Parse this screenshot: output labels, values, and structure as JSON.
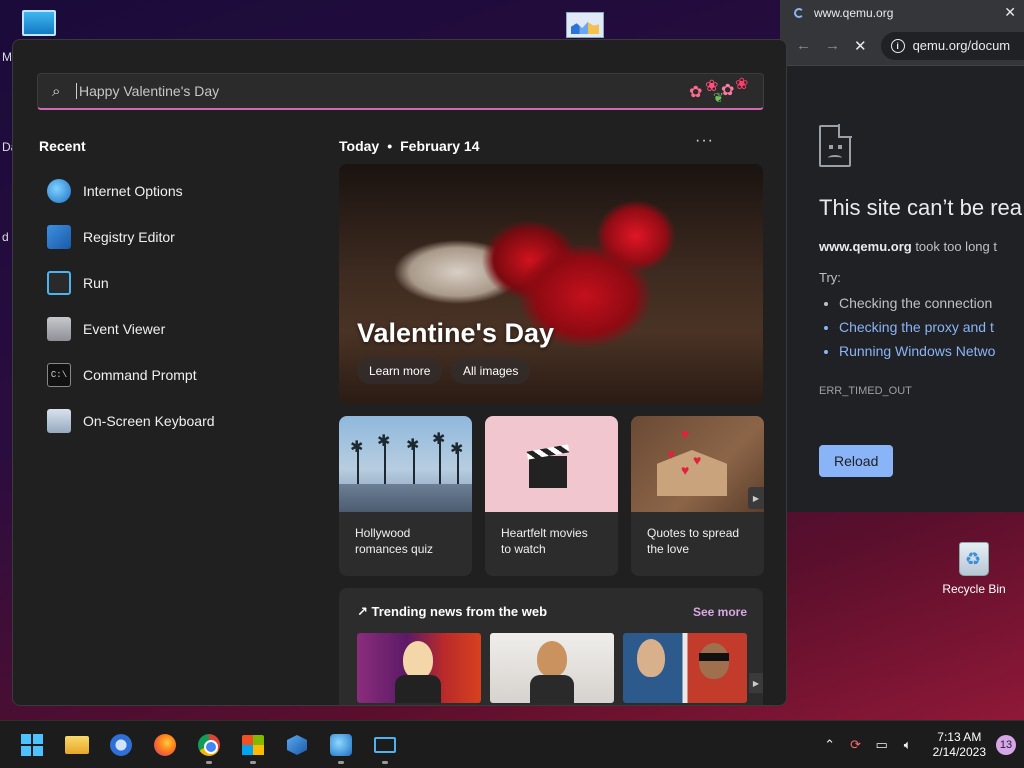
{
  "desktop": {
    "left_letters": [
      "M",
      "Da",
      "d"
    ],
    "recycle_bin_label": "Recycle Bin"
  },
  "browser": {
    "tab_title": "www.qemu.org",
    "tab_close": "✕",
    "url": "qemu.org/docum",
    "error_heading": "This site can’t be rea",
    "msg_host": "www.qemu.org",
    "msg_rest": " took too long t",
    "try_label": "Try:",
    "suggestions": [
      "Checking the connection",
      "Checking the proxy and t",
      "Running Windows Netwo"
    ],
    "error_code": "ERR_TIMED_OUT",
    "reload_label": "Reload"
  },
  "search": {
    "placeholder": "Happy Valentine's Day"
  },
  "recent": {
    "title": "Recent",
    "items": [
      {
        "label": "Internet Options",
        "icon": "internet-options-icon"
      },
      {
        "label": "Registry Editor",
        "icon": "registry-editor-icon"
      },
      {
        "label": "Run",
        "icon": "run-icon"
      },
      {
        "label": "Event Viewer",
        "icon": "event-viewer-icon"
      },
      {
        "label": "Command Prompt",
        "icon": "command-prompt-icon"
      },
      {
        "label": "On-Screen Keyboard",
        "icon": "on-screen-keyboard-icon"
      }
    ]
  },
  "today": {
    "label": "Today",
    "separator": "•",
    "date": "February 14",
    "more": "···",
    "hero_title": "Valentine's Day",
    "learn_more": "Learn more",
    "all_images": "All images"
  },
  "cards": [
    {
      "line1": "Hollywood",
      "line2": "romances quiz"
    },
    {
      "line1": "Heartfelt movies",
      "line2": "to watch"
    },
    {
      "line1": "Quotes to spread",
      "line2": "the love"
    }
  ],
  "trending": {
    "title": "Trending news from the web",
    "see_more": "See more"
  },
  "taskbar": {
    "time": "7:13 AM",
    "date": "2/14/2023",
    "notification_count": "13"
  },
  "colors": {
    "accent_pink": "#d06ab5",
    "link_blue": "#8ab4f8",
    "see_more": "#d7a7e6",
    "win_blue": "#4cc2ff"
  }
}
